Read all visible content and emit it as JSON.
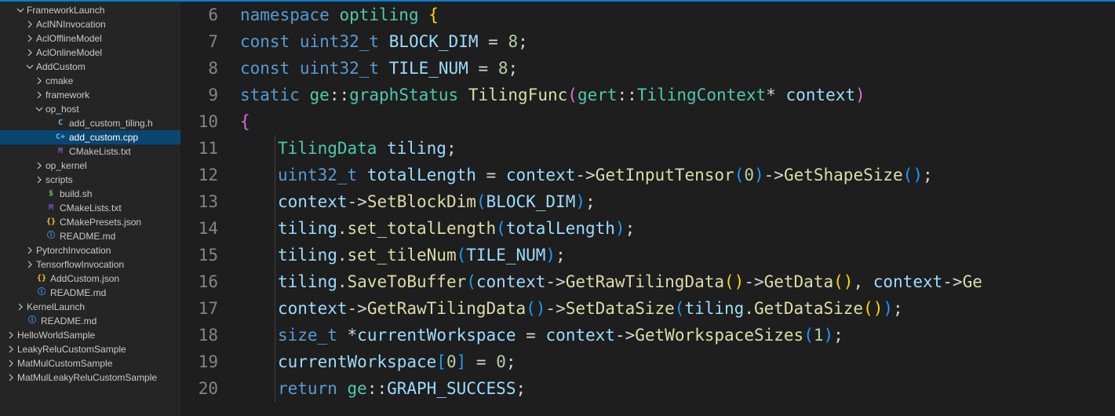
{
  "sidebar": {
    "items": [
      {
        "depth": 0,
        "kind": "folder",
        "open": true,
        "label": "FrameworkLaunch"
      },
      {
        "depth": 1,
        "kind": "folder",
        "open": false,
        "label": "AclNNInvocation"
      },
      {
        "depth": 1,
        "kind": "folder",
        "open": false,
        "label": "AclOfflineModel"
      },
      {
        "depth": 1,
        "kind": "folder",
        "open": false,
        "label": "AclOnlineModel"
      },
      {
        "depth": 1,
        "kind": "folder",
        "open": true,
        "label": "AddCustom"
      },
      {
        "depth": 2,
        "kind": "folder",
        "open": false,
        "label": "cmake"
      },
      {
        "depth": 2,
        "kind": "folder",
        "open": false,
        "label": "framework"
      },
      {
        "depth": 2,
        "kind": "folder",
        "open": true,
        "label": "op_host"
      },
      {
        "depth": 3,
        "kind": "file",
        "icon": "c",
        "label": "add_custom_tiling.h"
      },
      {
        "depth": 3,
        "kind": "file",
        "icon": "cpp",
        "label": "add_custom.cpp",
        "selected": true
      },
      {
        "depth": 3,
        "kind": "file",
        "icon": "cmake",
        "label": "CMakeLists.txt"
      },
      {
        "depth": 2,
        "kind": "folder",
        "open": false,
        "label": "op_kernel"
      },
      {
        "depth": 2,
        "kind": "folder",
        "open": false,
        "label": "scripts"
      },
      {
        "depth": 2,
        "kind": "file",
        "icon": "sh",
        "label": "build.sh"
      },
      {
        "depth": 2,
        "kind": "file",
        "icon": "cmake",
        "label": "CMakeLists.txt"
      },
      {
        "depth": 2,
        "kind": "file",
        "icon": "json",
        "label": "CMakePresets.json"
      },
      {
        "depth": 2,
        "kind": "file",
        "icon": "readme",
        "label": "README.md"
      },
      {
        "depth": 1,
        "kind": "folder",
        "open": false,
        "label": "PytorchInvocation"
      },
      {
        "depth": 1,
        "kind": "folder",
        "open": false,
        "label": "TensorflowInvocation"
      },
      {
        "depth": 1,
        "kind": "file",
        "icon": "json",
        "label": "AddCustom.json"
      },
      {
        "depth": 1,
        "kind": "file",
        "icon": "readme",
        "label": "README.md"
      },
      {
        "depth": 0,
        "kind": "folder",
        "open": false,
        "label": "KernelLaunch"
      },
      {
        "depth": 0,
        "kind": "file",
        "icon": "readme",
        "label": "README.md"
      },
      {
        "depth": -1,
        "kind": "folder",
        "open": false,
        "label": "HelloWorldSample"
      },
      {
        "depth": -1,
        "kind": "folder",
        "open": false,
        "label": "LeakyReluCustomSample"
      },
      {
        "depth": -1,
        "kind": "folder",
        "open": false,
        "label": "MatMulCustomSample"
      },
      {
        "depth": -1,
        "kind": "folder",
        "open": false,
        "label": "MatMulLeakyReluCustomSample"
      }
    ]
  },
  "editor": {
    "first_line": 6,
    "lines": [
      {
        "indent": 0,
        "tokens": [
          [
            "kw",
            "namespace"
          ],
          [
            "sp",
            " "
          ],
          [
            "ns",
            "optiling"
          ],
          [
            "sp",
            " "
          ],
          [
            "br",
            "{"
          ]
        ]
      },
      {
        "indent": 0,
        "tokens": [
          [
            "kw",
            "const"
          ],
          [
            "sp",
            " "
          ],
          [
            "type",
            "uint32_t"
          ],
          [
            "sp",
            " "
          ],
          [
            "var",
            "BLOCK_DIM"
          ],
          [
            "sp",
            " "
          ],
          [
            "op",
            "="
          ],
          [
            "sp",
            " "
          ],
          [
            "num",
            "8"
          ],
          [
            "punc",
            ";"
          ]
        ]
      },
      {
        "indent": 0,
        "tokens": [
          [
            "kw",
            "const"
          ],
          [
            "sp",
            " "
          ],
          [
            "type",
            "uint32_t"
          ],
          [
            "sp",
            " "
          ],
          [
            "var",
            "TILE_NUM"
          ],
          [
            "sp",
            " "
          ],
          [
            "op",
            "="
          ],
          [
            "sp",
            " "
          ],
          [
            "num",
            "8"
          ],
          [
            "punc",
            ";"
          ]
        ]
      },
      {
        "indent": 0,
        "tokens": [
          [
            "kw",
            "static"
          ],
          [
            "sp",
            " "
          ],
          [
            "ctype",
            "ge"
          ],
          [
            "punc",
            "::"
          ],
          [
            "ctype",
            "graphStatus"
          ],
          [
            "sp",
            " "
          ],
          [
            "func",
            "TilingFunc"
          ],
          [
            "br2",
            "("
          ],
          [
            "ctype",
            "gert"
          ],
          [
            "punc",
            "::"
          ],
          [
            "ctype",
            "TilingContext"
          ],
          [
            "op",
            "*"
          ],
          [
            "sp",
            " "
          ],
          [
            "var",
            "context"
          ],
          [
            "br2",
            ")"
          ]
        ]
      },
      {
        "indent": 0,
        "tokens": [
          [
            "br2",
            "{"
          ]
        ]
      },
      {
        "indent": 1,
        "tokens": [
          [
            "ctype",
            "TilingData"
          ],
          [
            "sp",
            " "
          ],
          [
            "var",
            "tiling"
          ],
          [
            "punc",
            ";"
          ]
        ]
      },
      {
        "indent": 1,
        "tokens": [
          [
            "type",
            "uint32_t"
          ],
          [
            "sp",
            " "
          ],
          [
            "var",
            "totalLength"
          ],
          [
            "sp",
            " "
          ],
          [
            "op",
            "="
          ],
          [
            "sp",
            " "
          ],
          [
            "var",
            "context"
          ],
          [
            "op",
            "->"
          ],
          [
            "func",
            "GetInputTensor"
          ],
          [
            "br3",
            "("
          ],
          [
            "num",
            "0"
          ],
          [
            "br3",
            ")"
          ],
          [
            "op",
            "->"
          ],
          [
            "func",
            "GetShapeSize"
          ],
          [
            "br3",
            "("
          ],
          [
            "br3",
            ")"
          ],
          [
            "punc",
            ";"
          ]
        ]
      },
      {
        "indent": 1,
        "tokens": [
          [
            "var",
            "context"
          ],
          [
            "op",
            "->"
          ],
          [
            "func",
            "SetBlockDim"
          ],
          [
            "br3",
            "("
          ],
          [
            "var",
            "BLOCK_DIM"
          ],
          [
            "br3",
            ")"
          ],
          [
            "punc",
            ";"
          ]
        ]
      },
      {
        "indent": 1,
        "tokens": [
          [
            "var",
            "tiling"
          ],
          [
            "punc",
            "."
          ],
          [
            "func",
            "set_totalLength"
          ],
          [
            "br3",
            "("
          ],
          [
            "var",
            "totalLength"
          ],
          [
            "br3",
            ")"
          ],
          [
            "punc",
            ";"
          ]
        ]
      },
      {
        "indent": 1,
        "tokens": [
          [
            "var",
            "tiling"
          ],
          [
            "punc",
            "."
          ],
          [
            "func",
            "set_tileNum"
          ],
          [
            "br3",
            "("
          ],
          [
            "var",
            "TILE_NUM"
          ],
          [
            "br3",
            ")"
          ],
          [
            "punc",
            ";"
          ]
        ]
      },
      {
        "indent": 1,
        "tokens": [
          [
            "var",
            "tiling"
          ],
          [
            "punc",
            "."
          ],
          [
            "func",
            "SaveToBuffer"
          ],
          [
            "br3",
            "("
          ],
          [
            "var",
            "context"
          ],
          [
            "op",
            "->"
          ],
          [
            "func",
            "GetRawTilingData"
          ],
          [
            "br",
            "("
          ],
          [
            "br",
            ")"
          ],
          [
            "op",
            "->"
          ],
          [
            "func",
            "GetData"
          ],
          [
            "br",
            "("
          ],
          [
            "br",
            ")"
          ],
          [
            "punc",
            ","
          ],
          [
            "sp",
            " "
          ],
          [
            "var",
            "context"
          ],
          [
            "op",
            "->"
          ],
          [
            "func",
            "Ge"
          ]
        ]
      },
      {
        "indent": 1,
        "tokens": [
          [
            "var",
            "context"
          ],
          [
            "op",
            "->"
          ],
          [
            "func",
            "GetRawTilingData"
          ],
          [
            "br3",
            "("
          ],
          [
            "br3",
            ")"
          ],
          [
            "op",
            "->"
          ],
          [
            "func",
            "SetDataSize"
          ],
          [
            "br3",
            "("
          ],
          [
            "var",
            "tiling"
          ],
          [
            "punc",
            "."
          ],
          [
            "func",
            "GetDataSize"
          ],
          [
            "br",
            "("
          ],
          [
            "br",
            ")"
          ],
          [
            "br3",
            ")"
          ],
          [
            "punc",
            ";"
          ]
        ]
      },
      {
        "indent": 1,
        "tokens": [
          [
            "type",
            "size_t"
          ],
          [
            "sp",
            " "
          ],
          [
            "op",
            "*"
          ],
          [
            "var",
            "currentWorkspace"
          ],
          [
            "sp",
            " "
          ],
          [
            "op",
            "="
          ],
          [
            "sp",
            " "
          ],
          [
            "var",
            "context"
          ],
          [
            "op",
            "->"
          ],
          [
            "func",
            "GetWorkspaceSizes"
          ],
          [
            "br3",
            "("
          ],
          [
            "num",
            "1"
          ],
          [
            "br3",
            ")"
          ],
          [
            "punc",
            ";"
          ]
        ]
      },
      {
        "indent": 1,
        "tokens": [
          [
            "var",
            "currentWorkspace"
          ],
          [
            "br3",
            "["
          ],
          [
            "num",
            "0"
          ],
          [
            "br3",
            "]"
          ],
          [
            "sp",
            " "
          ],
          [
            "op",
            "="
          ],
          [
            "sp",
            " "
          ],
          [
            "num",
            "0"
          ],
          [
            "punc",
            ";"
          ]
        ]
      },
      {
        "indent": 1,
        "tokens": [
          [
            "kw",
            "return"
          ],
          [
            "sp",
            " "
          ],
          [
            "ctype",
            "ge"
          ],
          [
            "punc",
            "::"
          ],
          [
            "var",
            "GRAPH_SUCCESS"
          ],
          [
            "punc",
            ";"
          ]
        ]
      }
    ]
  }
}
